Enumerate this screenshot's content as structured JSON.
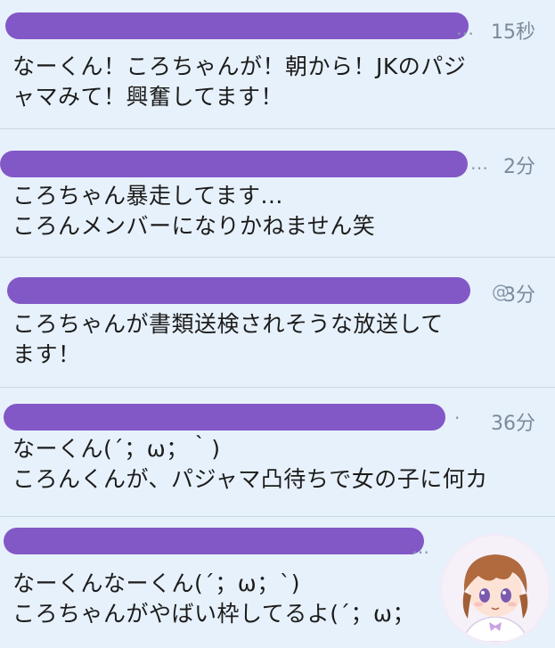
{
  "tweets": [
    {
      "time": "15秒",
      "header_tail": "…",
      "text": "なーくん！ころちゃんが！朝から！JKのパジ\nャマみて！興奮してます！"
    },
    {
      "time": "2分",
      "header_tail": "…",
      "text": "ころちゃん暴走してます...\nころんメンバーになりかねません笑"
    },
    {
      "time": "3分",
      "header_tail": "@",
      "text": "ころちゃんが書類送検されそうな放送して\nます！"
    },
    {
      "time": "36分",
      "header_tail": "·",
      "text": "なーくん(´；ω；｀)\nころんくんが、パジャマ凸待ちで女の子に何カ"
    },
    {
      "time": "",
      "header_tail": "…",
      "text": "なーくんなーくん(´；ω；`)\nころちゃんがやばい枠してるよ(´；ω；"
    }
  ],
  "colors": {
    "background": "#e7f1fb",
    "redaction": "#7c4fc4",
    "timestamp": "#7b8b9c",
    "divider": "#c9d6e3"
  },
  "icons": {
    "avatar": "anime-character-avatar"
  }
}
